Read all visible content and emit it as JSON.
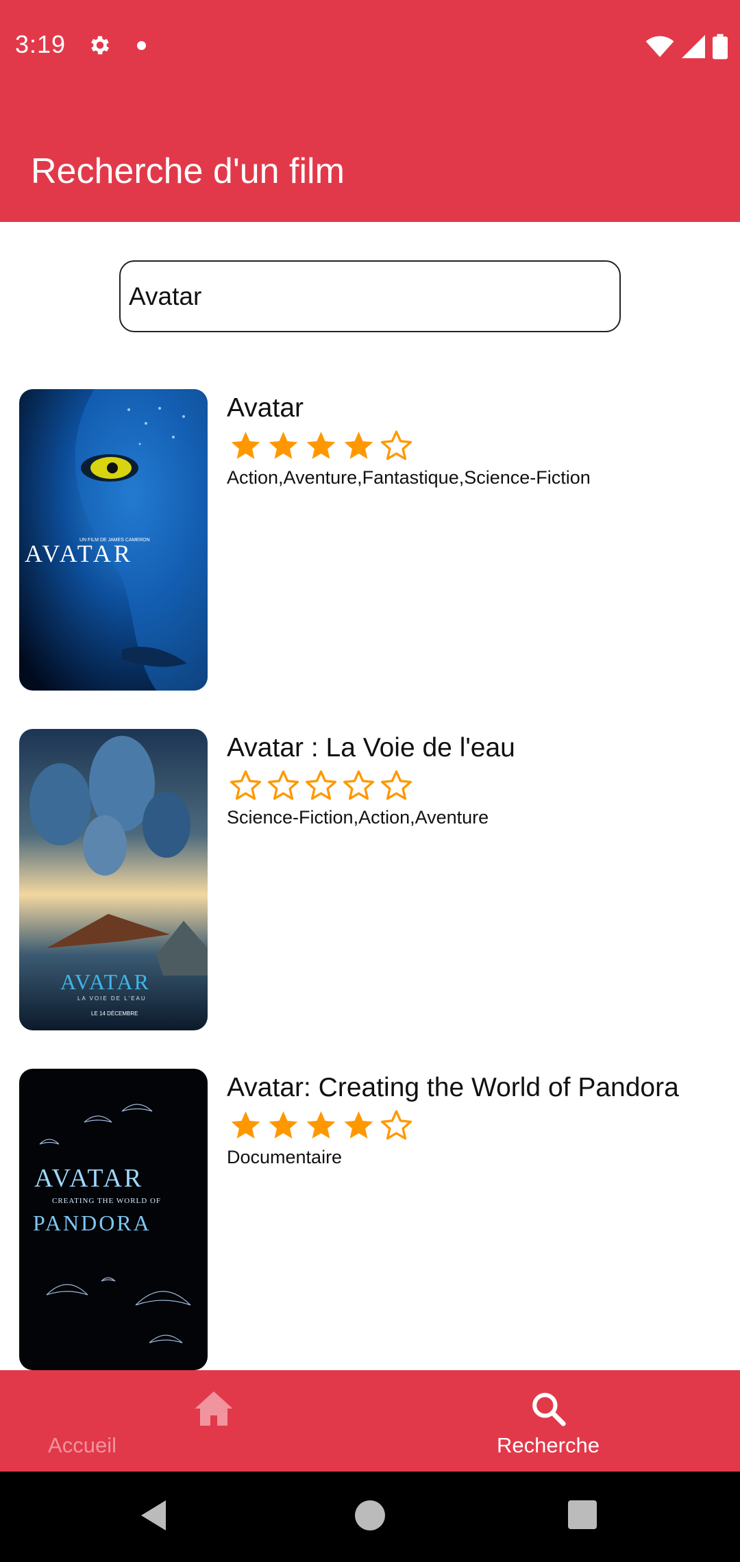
{
  "status_bar": {
    "time": "3:19",
    "icons": [
      "gear-icon",
      "dot-icon",
      "wifi-icon",
      "signal-icon",
      "battery-icon"
    ]
  },
  "app_bar": {
    "title": "Recherche d'un film"
  },
  "search": {
    "value": "Avatar"
  },
  "movies": [
    {
      "title": "Avatar",
      "rating": 4,
      "genres": "Action,Aventure,Fantastique,Science-Fiction",
      "poster_text": [
        "UN FILM DE JAMES CAMERON",
        "AVATAR"
      ]
    },
    {
      "title": "Avatar : La Voie de l'eau",
      "rating": 0,
      "genres": "Science-Fiction,Action,Aventure",
      "poster_text": [
        "AVATAR",
        "LA VOIE DE L'EAU",
        "LE 14 DÉCEMBRE"
      ]
    },
    {
      "title": "Avatar: Creating the World of Pandora",
      "rating": 4,
      "genres": "Documentaire",
      "poster_text": [
        "AVATAR",
        "CREATING THE WORLD OF",
        "PANDORA"
      ]
    }
  ],
  "bottom_nav": {
    "items": [
      {
        "label": "Accueil",
        "icon": "home-icon",
        "active": false
      },
      {
        "label": "Recherche",
        "icon": "search-icon",
        "active": true
      }
    ]
  },
  "colors": {
    "primary": "#e2394a",
    "star": "#ff9800",
    "inactive_nav": "#f1949d"
  }
}
